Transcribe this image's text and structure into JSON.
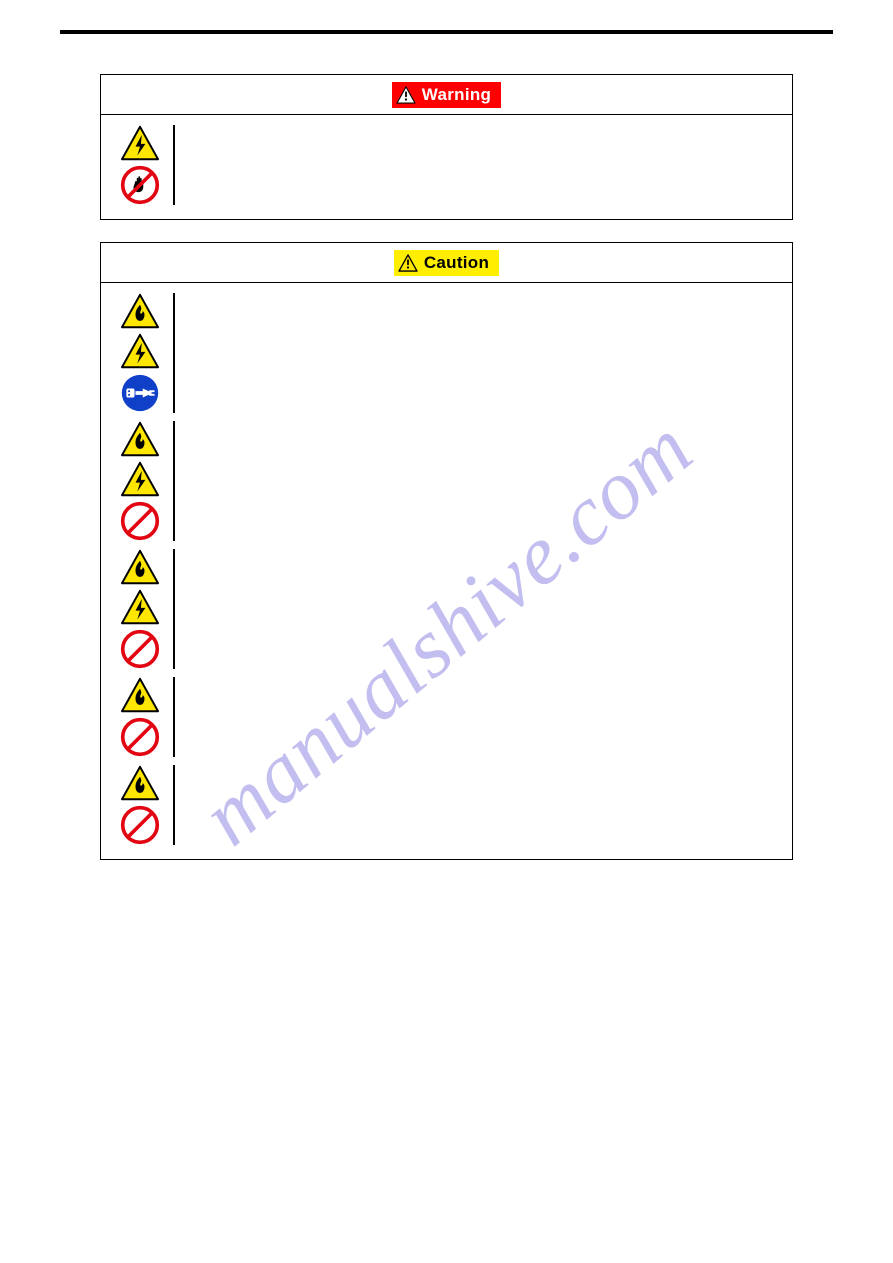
{
  "header": {
    "warning_label": "Warning",
    "caution_label": "Caution"
  },
  "watermark": "manualshive.com"
}
